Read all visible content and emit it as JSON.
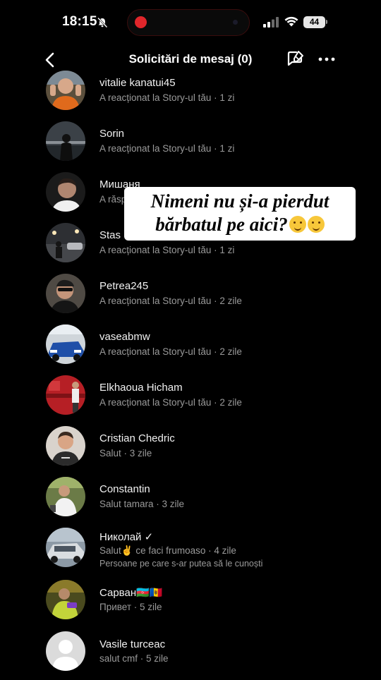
{
  "status_bar": {
    "time": "18:15",
    "battery": "44"
  },
  "header": {
    "title": "Solicitări de mesaj (0)"
  },
  "sticker": {
    "line1": "Nimeni nu și-a pierdut",
    "line2": "bărbatul pe aici?"
  },
  "requests": [
    {
      "name": "vitalie kanatui45",
      "message": "A reacționat la Story-ul tău · 1 zi"
    },
    {
      "name": "Sorin",
      "message": "A reacționat la Story-ul tău · 1 zi"
    },
    {
      "name": "Мишаня",
      "message": "A răsp"
    },
    {
      "name": "Stas",
      "message": "A reacționat la Story-ul tău · 1 zi"
    },
    {
      "name": "Petrea245",
      "message": "A reacționat la Story-ul tău · 2 zile"
    },
    {
      "name": "vaseabmw",
      "message": "A reacționat la Story-ul tău · 2 zile"
    },
    {
      "name": "Elkhaoua Hicham",
      "message": "A reacționat la Story-ul tău · 2 zile"
    },
    {
      "name": "Cristian Chedric",
      "message": "Salut · 3 zile"
    },
    {
      "name": "Constantin",
      "message": "Salut tamara · 3 zile"
    },
    {
      "name": "Николай ✓",
      "message": "Salut✌️ ce faci frumoaso · 4 zile",
      "extra": "Persoane pe care s-ar putea să le cunoști"
    },
    {
      "name": "Сарван🇦🇿🇲🇩",
      "message": "Привет · 5 zile"
    },
    {
      "name": "Vasile turceac",
      "message": "salut cmf · 5 zile"
    }
  ],
  "colors": {
    "background": "#000000",
    "secondary_text": "#9a9a9a",
    "sticker_bg": "#ffffff",
    "recording": "#e0262b"
  },
  "icons": [
    "bell-muted-icon",
    "signal-icon",
    "wifi-icon",
    "battery-icon",
    "back-icon",
    "compose-icon",
    "more-icon"
  ]
}
